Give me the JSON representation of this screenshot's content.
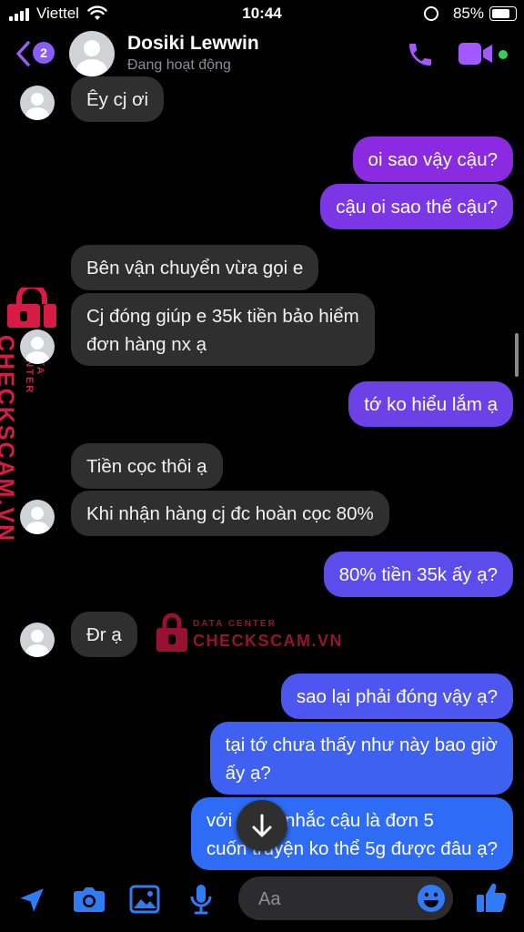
{
  "status_bar": {
    "carrier": "Viettel",
    "time": "10:44",
    "battery": "85%",
    "battery_level": 0.85
  },
  "header": {
    "back_count": "2",
    "contact_name": "Dosiki Lewwin",
    "contact_status": "Đang hoạt động"
  },
  "messages": [
    {
      "from": "contact",
      "text": "Êy cj ơi"
    },
    {
      "from": "me",
      "text": "oi sao vậy cậu?"
    },
    {
      "from": "me",
      "text": "cậu oi sao thế cậu?"
    },
    {
      "from": "contact",
      "text": "Bên vận chuyển vừa gọi e"
    },
    {
      "from": "contact",
      "line1": "Cj đóng giúp e 35k tiền bảo hiểm",
      "line2": "đơn hàng nx ạ"
    },
    {
      "from": "me",
      "text": "tớ ko hiểu lắm ạ"
    },
    {
      "from": "contact",
      "text": "Tiền cọc thôi ạ"
    },
    {
      "from": "contact",
      "text": "Khi nhận hàng cj đc hoàn cọc 80%"
    },
    {
      "from": "me",
      "text": "80% tiền 35k ấy ạ?"
    },
    {
      "from": "contact",
      "text": "Đr ạ"
    },
    {
      "from": "me",
      "text": "sao lại phải đóng vậy ạ?"
    },
    {
      "from": "me",
      "line1": "tại tớ chưa thấy như này bao giờ",
      "line2": "ấy ạ?"
    },
    {
      "from": "me",
      "line1": "với cả tớ nhắc cậu là đơn 5",
      "line2": "cuốn truyện ko thể 5g được đâu ạ?"
    }
  ],
  "watermark": {
    "label": "DATA CENTER",
    "brand": "CHECKSCAM.VN"
  },
  "composer": {
    "placeholder": "Aa"
  },
  "colors": {
    "accent": "#8b5cf6",
    "bubble_in": "#2f2f2f",
    "bubble_out_top": "#8a2be2",
    "bubble_out_bottom": "#2f6cf5",
    "online": "#31d158",
    "watermark": "#d81b45"
  },
  "icons": [
    "back-chevron-icon",
    "phone-icon",
    "video-camera-icon",
    "location-arrow-icon",
    "camera-icon",
    "gallery-icon",
    "microphone-icon",
    "emoji-icon",
    "thumbs-up-icon",
    "arrow-down-icon"
  ]
}
